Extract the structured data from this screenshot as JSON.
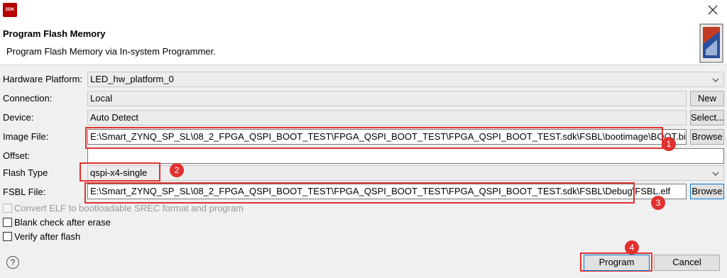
{
  "window": {
    "icon_label": "SDK",
    "close_icon": "close-icon"
  },
  "header": {
    "title": "Program Flash Memory",
    "description": "Program Flash Memory via In-system Programmer."
  },
  "form": {
    "hardware_platform": {
      "label": "Hardware Platform:",
      "value": "LED_hw_platform_0"
    },
    "connection": {
      "label": "Connection:",
      "value": "Local",
      "button": "New"
    },
    "device": {
      "label": "Device:",
      "value": "Auto Detect",
      "button": "Select..."
    },
    "image_file": {
      "label": "Image File:",
      "value": "E:\\Smart_ZYNQ_SP_SL\\08_2_FPGA_QSPI_BOOT_TEST\\FPGA_QSPI_BOOT_TEST\\FPGA_QSPI_BOOT_TEST.sdk\\FSBL\\bootimage\\BOOT.bin",
      "button": "Browse"
    },
    "offset": {
      "label": "Offset:",
      "value": ""
    },
    "flash_type": {
      "label": "Flash Type",
      "value": "qspi-x4-single"
    },
    "fsbl_file": {
      "label": "FSBL File:",
      "value": "E:\\Smart_ZYNQ_SP_SL\\08_2_FPGA_QSPI_BOOT_TEST\\FPGA_QSPI_BOOT_TEST\\FPGA_QSPI_BOOT_TEST.sdk\\FSBL\\Debug\\FSBL.elf",
      "button": "Browse"
    }
  },
  "options": {
    "convert_elf": {
      "label": "Convert ELF to bootloadable SREC format and program",
      "checked": false,
      "enabled": false
    },
    "blank_check": {
      "label": "Blank check after erase",
      "checked": false,
      "enabled": true
    },
    "verify": {
      "label": "Verify after flash",
      "checked": false,
      "enabled": true
    }
  },
  "annotations": [
    "1",
    "2",
    "3",
    "4"
  ],
  "footer": {
    "help": "?",
    "program": "Program",
    "cancel": "Cancel"
  },
  "colors": {
    "annotation": "#e03131",
    "focus": "#0078d7"
  }
}
